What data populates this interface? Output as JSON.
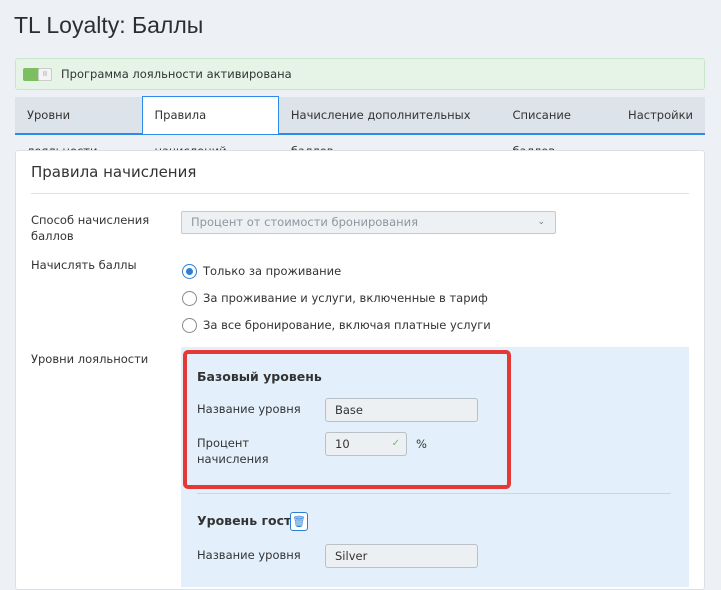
{
  "page_title": "TL Loyalty: Баллы",
  "banner": {
    "text": "Программа лояльности активирована",
    "toggle_on": true
  },
  "tabs": [
    {
      "label": "Уровни лояльности"
    },
    {
      "label": "Правила начислений",
      "active": true
    },
    {
      "label": "Начисление дополнительных баллов"
    },
    {
      "label": "Списание баллов"
    },
    {
      "label": "Настройки"
    }
  ],
  "section": {
    "title": "Правила начисления",
    "method_label_1": "Способ начисления",
    "method_label_2": "баллов",
    "method_value": "Процент от стоимости бронирования",
    "accrue_label": "Начислять баллы",
    "options": [
      "Только за проживание",
      "За проживание и услуги, включенные в тариф",
      "За все бронирование, включая платные услуги"
    ],
    "selected_option": 0,
    "levels_label": "Уровни лояльности",
    "levels": [
      {
        "title": "Базовый уровень",
        "name_label": "Название уровня",
        "name_value": "Base",
        "percent_label_1": "Процент",
        "percent_label_2": "начисления",
        "percent_value": "10",
        "percent_unit": "%"
      },
      {
        "title": "Уровень гостя",
        "name_label": "Название уровня",
        "name_value": "Silver"
      }
    ]
  }
}
